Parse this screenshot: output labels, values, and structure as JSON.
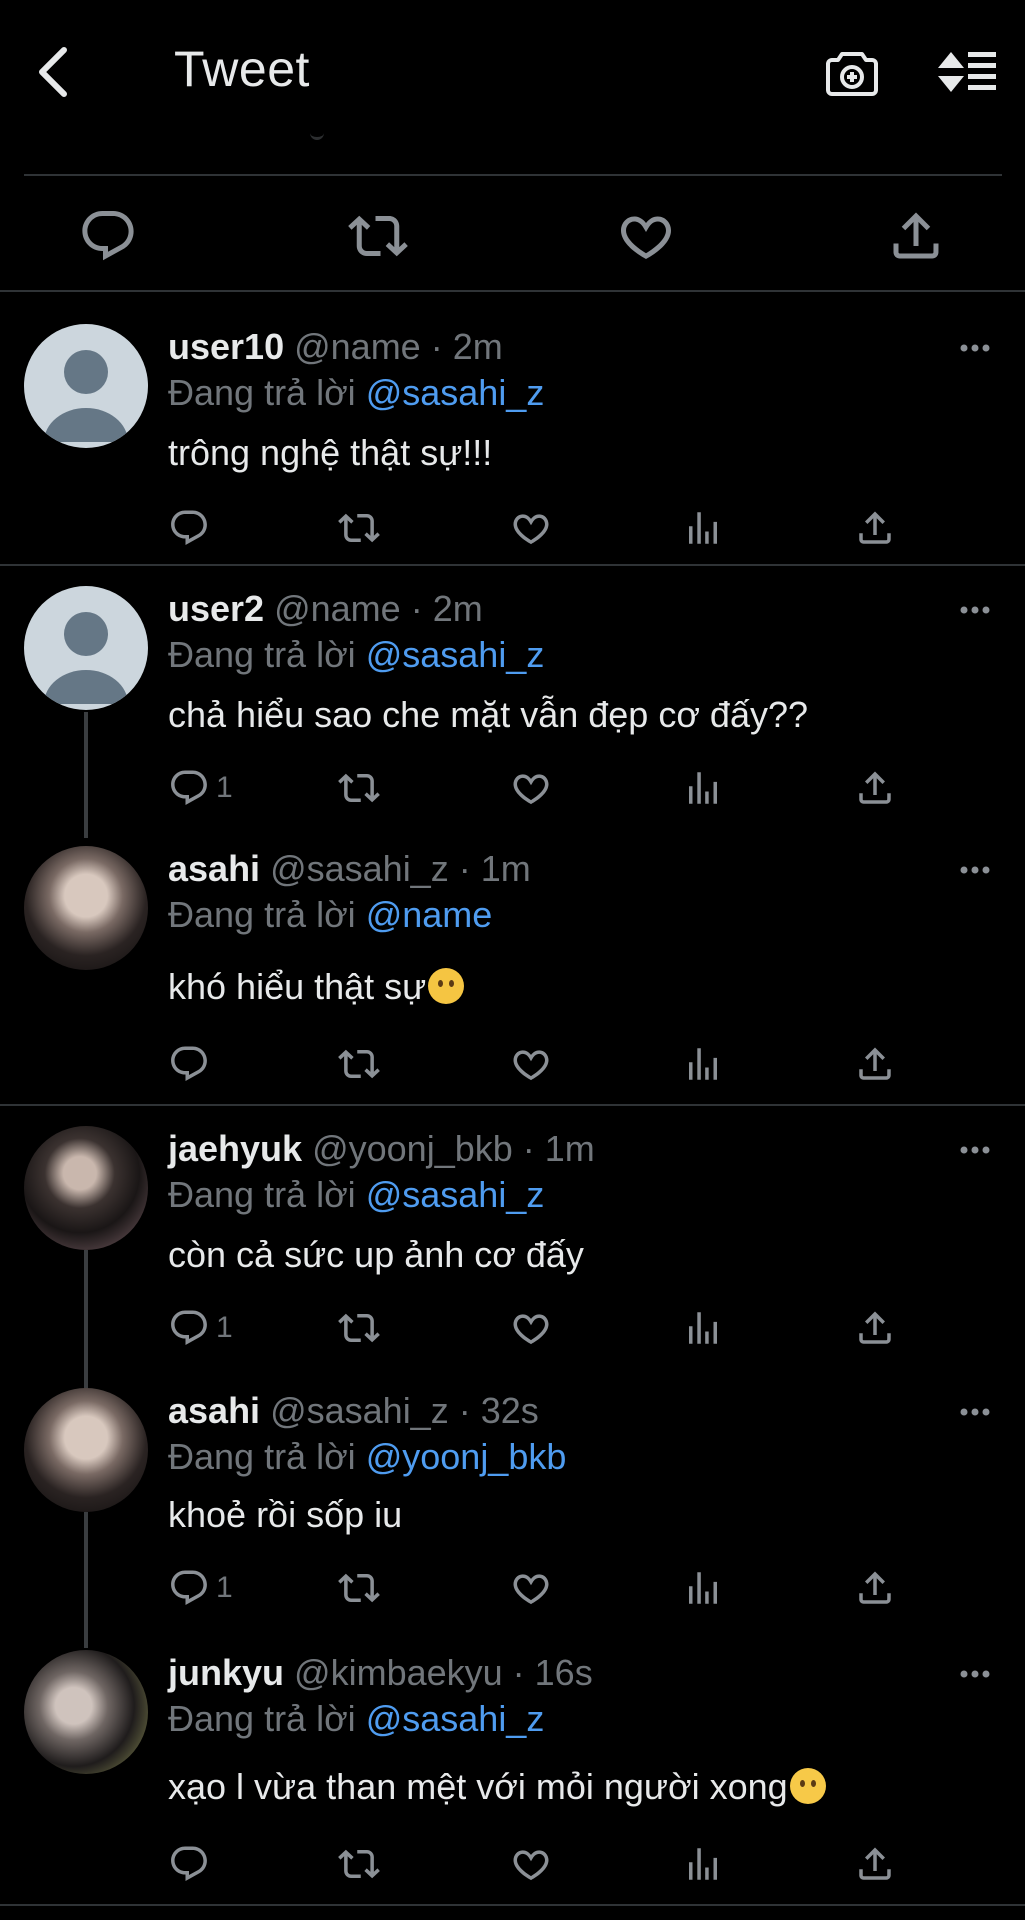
{
  "header": {
    "title": "Tweet",
    "icons": {
      "back": "chevron-left-icon",
      "camera": "camera-add-icon",
      "sort": "sort-icon"
    }
  },
  "main_actions": [
    "reply-icon",
    "retweet-icon",
    "like-icon",
    "share-icon"
  ],
  "replying_prefix": "Đang trả lời",
  "colors": {
    "background": "#000000",
    "text": "#e7e9ea",
    "muted": "#71767b",
    "mention": "#4f9cf0",
    "divider": "#2f3336"
  },
  "replies": [
    {
      "name": "user10",
      "handle": "@name",
      "time": "· 2m",
      "replying_to": "@sasahi_z",
      "text": "trông nghệ thật sự!!!",
      "reply_count": ""
    },
    {
      "name": "user2",
      "handle": "@name",
      "time": "· 2m",
      "replying_to": "@sasahi_z",
      "text": "chả hiểu sao che mặt vẫn đẹp cơ đấy??",
      "reply_count": "1"
    },
    {
      "name": "asahi",
      "handle": "@sasahi_z",
      "time": "· 1m",
      "replying_to": "@name",
      "text": "khó hiểu thật sự",
      "emoji": "crying-cat-emoji",
      "reply_count": ""
    },
    {
      "name": "jaehyuk",
      "handle": "@yoonj_bkb",
      "time": "· 1m",
      "replying_to": "@sasahi_z",
      "text": "còn cả sức up ảnh cơ đấy",
      "reply_count": "1"
    },
    {
      "name": "asahi",
      "handle": "@sasahi_z",
      "time": "· 32s",
      "replying_to": "@yoonj_bkb",
      "text": "khoẻ rồi sốp iu",
      "reply_count": "1"
    },
    {
      "name": "junkyu",
      "handle": "@kimbaekyu",
      "time": "· 16s",
      "replying_to": "@sasahi_z",
      "text": "xạo l vừa than mệt với mỏi người xong",
      "emoji": "slightly-smiling-emoji",
      "reply_count": ""
    }
  ]
}
